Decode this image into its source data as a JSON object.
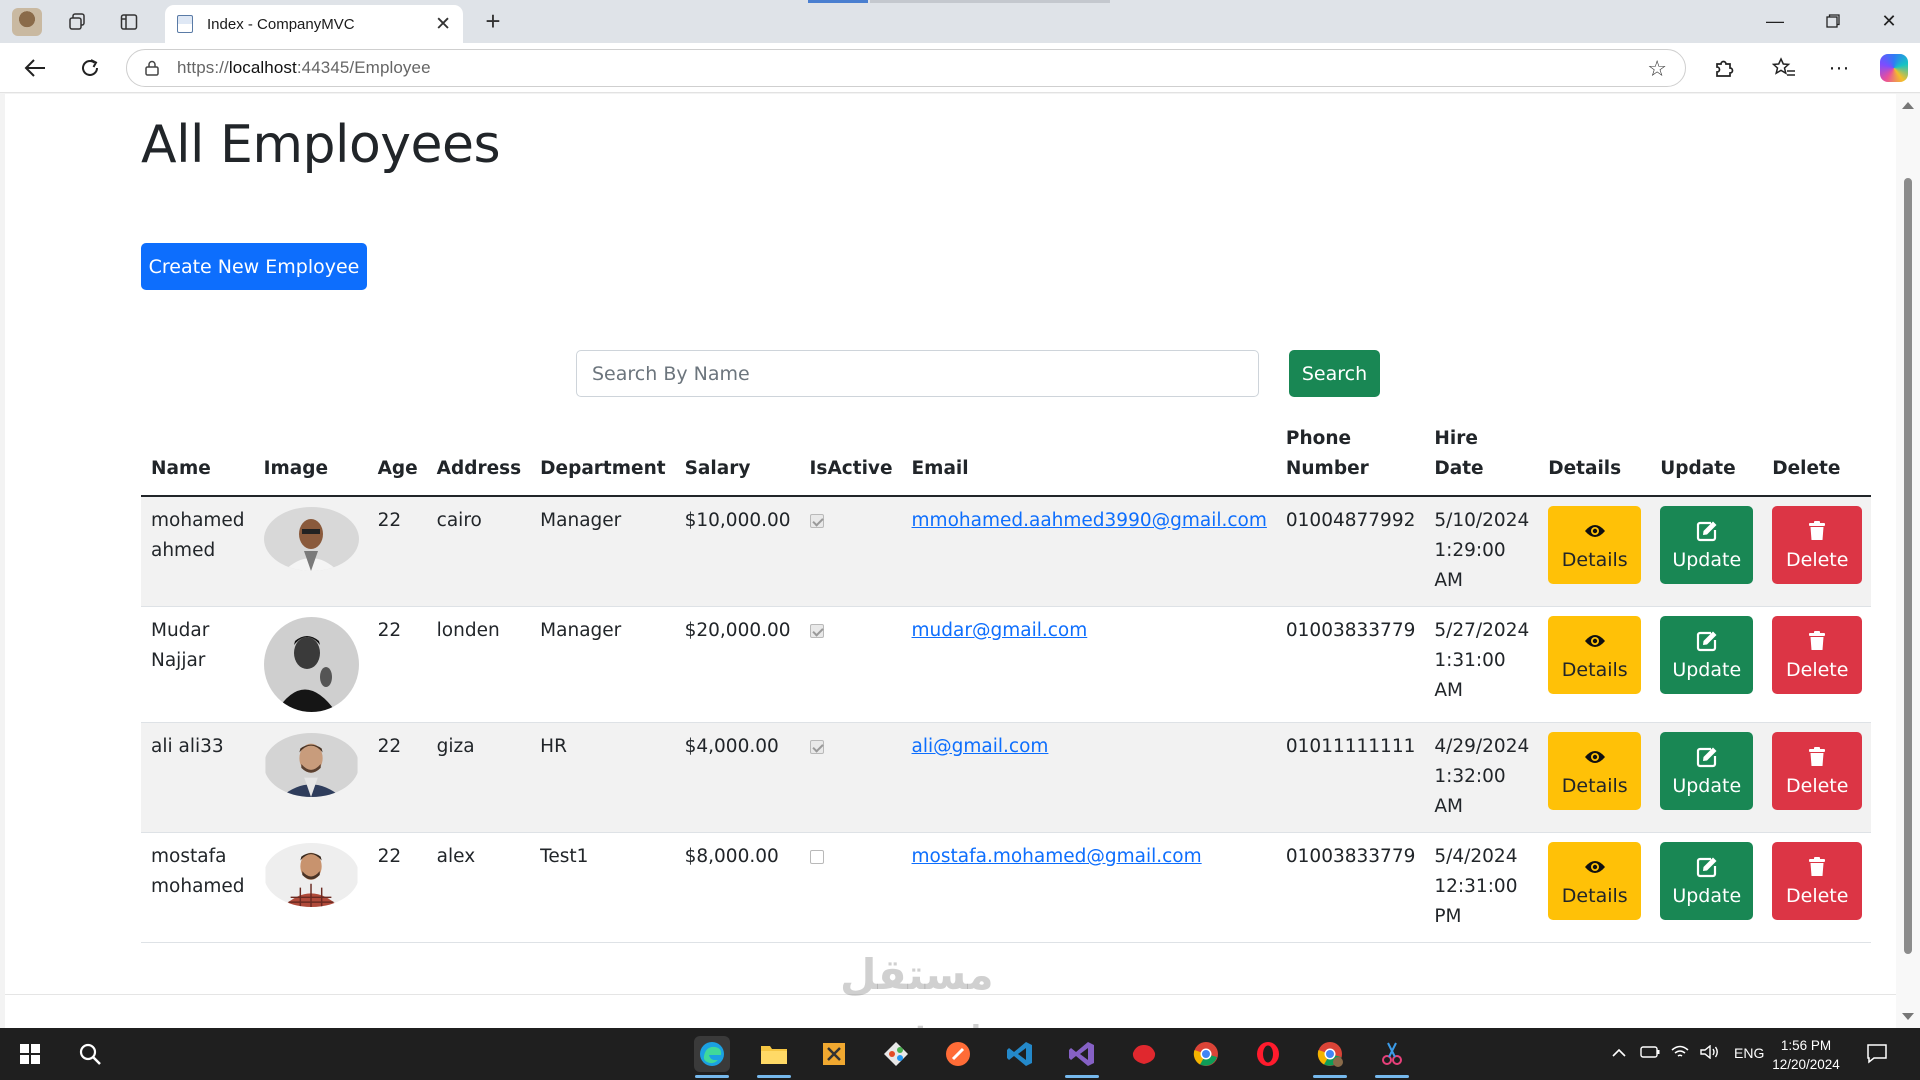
{
  "browser": {
    "tab_title": "Index - CompanyMVC",
    "url_prefix": "https://",
    "url_host": "localhost",
    "url_rest": ":44345/Employee"
  },
  "page": {
    "title": "All Employees",
    "create_button": "Create New Employee",
    "search_placeholder": "Search By Name",
    "search_button": "Search"
  },
  "table": {
    "headers": {
      "name": "Name",
      "image": "Image",
      "age": "Age",
      "address": "Address",
      "department": "Department",
      "salary": "Salary",
      "is_active": "IsActive",
      "email": "Email",
      "phone_line1": "Phone",
      "phone_line2": "Number",
      "hire_date": "Hire Date",
      "details": "Details",
      "update": "Update",
      "delete": "Delete"
    },
    "rows": [
      {
        "name": "mohamed ahmed",
        "age": "22",
        "address": "cairo",
        "department": "Manager",
        "salary": "$10,000.00",
        "is_active": true,
        "email": "mmohamed.aahmed3990@gmail.com",
        "phone": "01004877992",
        "hire_date": "5/10/2024 1:29:00 AM"
      },
      {
        "name": "Mudar Najjar",
        "age": "22",
        "address": "londen",
        "department": "Manager",
        "salary": "$20,000.00",
        "is_active": true,
        "email": "mudar@gmail.com",
        "phone": "01003833779",
        "hire_date": "5/27/2024 1:31:00 AM"
      },
      {
        "name": "ali ali33",
        "age": "22",
        "address": "giza",
        "department": "HR",
        "salary": "$4,000.00",
        "is_active": true,
        "email": "ali@gmail.com",
        "phone": "01011111111",
        "hire_date": "4/29/2024 1:32:00 AM"
      },
      {
        "name": "mostafa mohamed",
        "age": "22",
        "address": "alex",
        "department": "Test1",
        "salary": "$8,000.00",
        "is_active": false,
        "email": "mostafa.mohamed@gmail.com",
        "phone": "01003833779",
        "hire_date": "5/4/2024 12:31:00 PM"
      }
    ],
    "action_labels": {
      "details": "Details",
      "update": "Update",
      "delete": "Delete"
    }
  },
  "watermark": {
    "arabic": "مستقل",
    "latin": "mostaql.com"
  },
  "taskbar": {
    "language": "ENG",
    "time": "1:56 PM",
    "date": "12/20/2024"
  },
  "colors": {
    "primary": "#0d6efd",
    "success": "#198754",
    "warning": "#ffc107",
    "danger": "#dc3545"
  }
}
